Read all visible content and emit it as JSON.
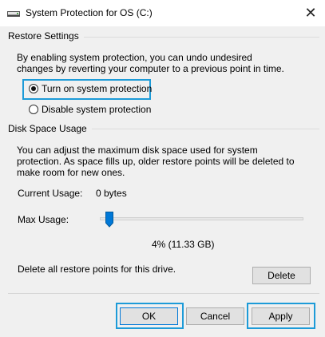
{
  "window": {
    "title": "System Protection for OS (C:)",
    "close_glyph": "✕",
    "icon": "drive-icon"
  },
  "restore_settings": {
    "group_label": "Restore Settings",
    "description": "By enabling system protection, you can undo undesired changes by reverting your computer to a previous point in time.",
    "options": [
      {
        "label": "Turn on system protection",
        "checked": true
      },
      {
        "label": "Disable system protection",
        "checked": false
      }
    ]
  },
  "disk_space": {
    "group_label": "Disk Space Usage",
    "description": "You can adjust the maximum disk space used for system protection. As space fills up, older restore points will be deleted to make room for new ones.",
    "current_usage_label": "Current Usage:",
    "current_usage_value": "0 bytes",
    "max_usage_label": "Max Usage:",
    "max_usage_percent": 4,
    "max_usage_readout": "4% (11.33 GB)",
    "delete_description": "Delete all restore points for this drive.",
    "delete_label": "Delete"
  },
  "buttons": {
    "ok": "OK",
    "cancel": "Cancel",
    "apply": "Apply"
  },
  "colors": {
    "highlight": "#1d9bd8",
    "dialog_bg": "#f0f0f0"
  }
}
